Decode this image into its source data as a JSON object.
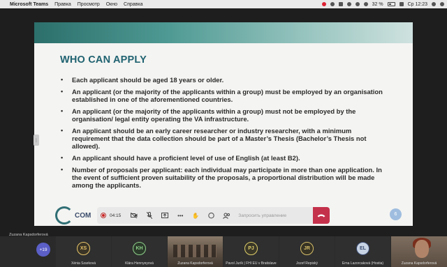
{
  "menubar": {
    "app": "Microsoft Teams",
    "items": [
      "Правка",
      "Просмотр",
      "Окно",
      "Справка"
    ],
    "battery": "32 %",
    "clock": "Ср 12:23"
  },
  "slide": {
    "title": "WHO CAN APPLY",
    "bullets": [
      "Each applicant should be aged 18 years or older.",
      "An applicant (or the majority of the applicants within a group) must be employed by an organisation established in one of the aforementioned countries.",
      "An applicant (or the majority of the applicants within a group) must not be employed by the organisation/ legal entity operating the VA infrastructure.",
      "An applicant should be an early career researcher or industry researcher, with a minimum requirement that the data collection should be part of a Master’s Thesis (Bachelor’s Thesis not allowed).",
      "An applicant should have a proficient level of use of English (at least B2).",
      "Number of proposals per applicant: each individual may participate in more than one application. In the event of sufficient proven suitability of the proposals, a proportional distribution will be made among the applicants."
    ],
    "bullet_symbol": "•",
    "logo_text": "COM",
    "page_number": "6"
  },
  "call": {
    "timer": "04:15",
    "request_control": "Запросить управление",
    "presenter": "Zuzana Kapsdorferová"
  },
  "participants": {
    "overflow_count": "+19",
    "tiles": [
      {
        "initials": "XS",
        "name": "Xénia Szarková",
        "bg": "#3a3426",
        "fg": "#e8c56a"
      },
      {
        "initials": "KH",
        "name": "Klára Hennyeyová",
        "bg": "#2b3a2b",
        "fg": "#8fd18a"
      },
      {
        "initials": "",
        "name": "Zuzana Kapsdorferová",
        "video": true
      },
      {
        "initials": "PJ",
        "name": "Pavol Jurík | FHI EU v Bratislave",
        "bg": "#3a3728",
        "fg": "#e0d06a"
      },
      {
        "initials": "JR",
        "name": "Jozef Repiský",
        "bg": "#363224",
        "fg": "#d8c06a"
      },
      {
        "initials": "EL",
        "name": "Erna Lazorcaková (Hostia)",
        "bg": "#c8d4e4",
        "fg": "#3a4b70"
      },
      {
        "initials": "",
        "name": "Zuzana Kapsdorferová",
        "video": true
      }
    ]
  },
  "colors": {
    "title": "#1f6270",
    "hangup": "#c4314b",
    "overflow_badge": "#5b5fc7"
  },
  "icons": [
    "apple-icon",
    "record-icon",
    "camera-off-icon",
    "mic-off-icon",
    "share-icon",
    "more-icon",
    "raise-hand-icon",
    "chat-icon",
    "people-icon",
    "hangup-icon"
  ]
}
